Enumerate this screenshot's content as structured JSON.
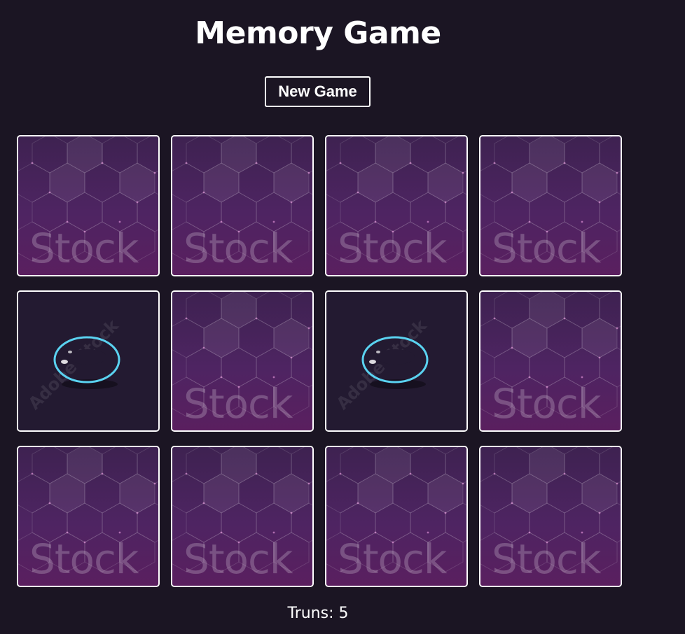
{
  "title": "Memory Game",
  "new_game_label": "New Game",
  "turns_label": "Truns: 5",
  "card_back_watermark": "Stock",
  "card_front_watermark": "Adobe Stock",
  "cards": [
    {
      "state": "hidden",
      "image": "card-back-hexagon-pattern"
    },
    {
      "state": "hidden",
      "image": "card-back-hexagon-pattern"
    },
    {
      "state": "hidden",
      "image": "card-back-hexagon-pattern"
    },
    {
      "state": "hidden",
      "image": "card-back-hexagon-pattern"
    },
    {
      "state": "flipped",
      "image": "gold-ring-icon"
    },
    {
      "state": "hidden",
      "image": "card-back-hexagon-pattern"
    },
    {
      "state": "flipped",
      "image": "gold-ring-icon"
    },
    {
      "state": "hidden",
      "image": "card-back-hexagon-pattern"
    },
    {
      "state": "hidden",
      "image": "card-back-hexagon-pattern"
    },
    {
      "state": "hidden",
      "image": "card-back-hexagon-pattern"
    },
    {
      "state": "hidden",
      "image": "card-back-hexagon-pattern"
    },
    {
      "state": "hidden",
      "image": "card-back-hexagon-pattern"
    }
  ],
  "colors": {
    "background": "#1b1523",
    "card_border": "#ffffff",
    "card_back": "#4e2462",
    "card_front": "#231a31",
    "ring_gold": "#f2b62a"
  }
}
